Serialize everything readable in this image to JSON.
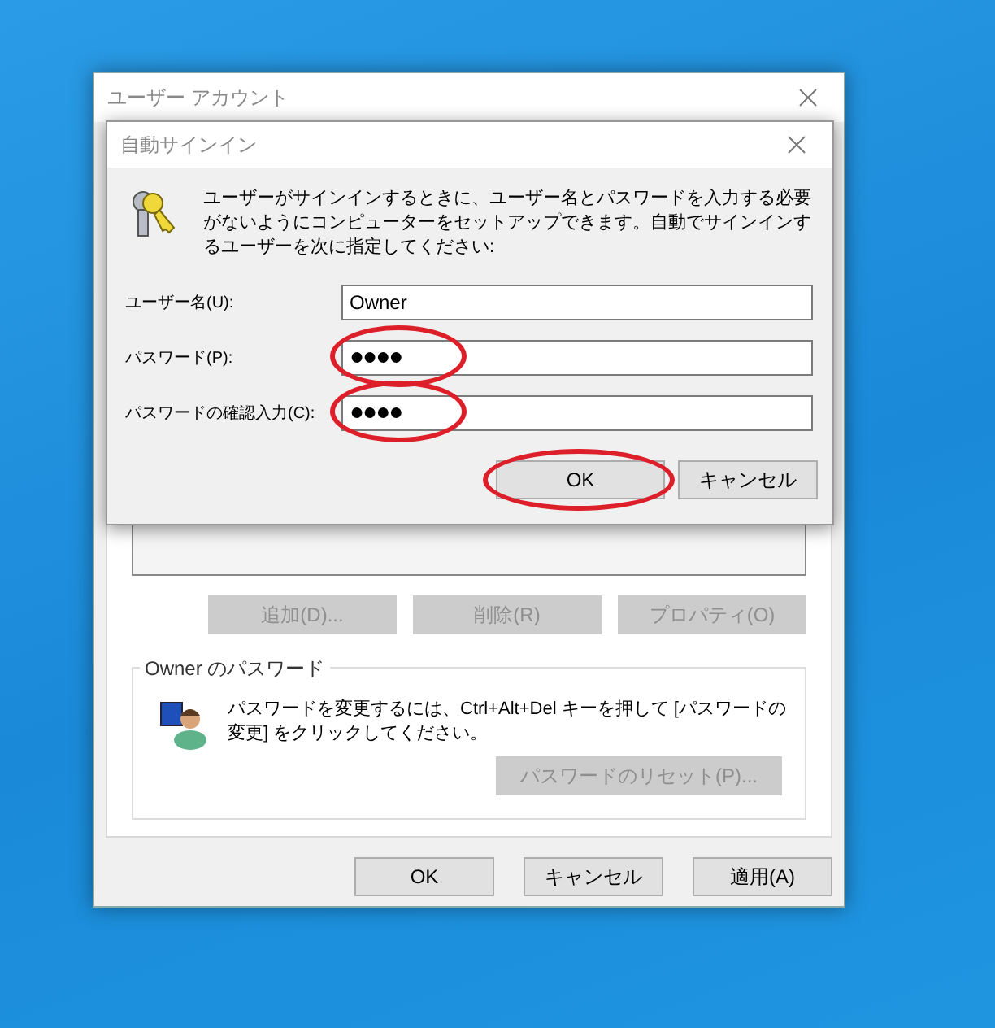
{
  "window": {
    "title": "ユーザー アカウント"
  },
  "list_buttons": [
    {
      "label": "追加(D)...",
      "disabled": true
    },
    {
      "label": "削除(R)",
      "disabled": true
    },
    {
      "label": "プロパティ(O)",
      "disabled": true
    }
  ],
  "password_group": {
    "title": "Owner のパスワード",
    "text": "パスワードを変更するには、Ctrl+Alt+Del キーを押して [パスワードの変更] をクリックしてください。",
    "reset_button": {
      "label": "パスワードのリセット(P)...",
      "disabled": true
    }
  },
  "buttons": [
    {
      "label": "OK"
    },
    {
      "label": "キャンセル"
    },
    {
      "label": "適用(A)"
    }
  ],
  "dialog": {
    "title": "自動サインイン",
    "description": "ユーザーがサインインするときに、ユーザー名とパスワードを入力する必要がないようにコンピューターをセットアップできます。自動でサインインするユーザーを次に指定してください:",
    "fields": [
      {
        "label": "ユーザー名(U):",
        "value": "Owner",
        "kind": "text",
        "highlighted": false
      },
      {
        "label": "パスワード(P):",
        "value": "●●●●",
        "kind": "password",
        "highlighted": true
      },
      {
        "label": "パスワードの確認入力(C):",
        "value": "●●●●",
        "kind": "password",
        "highlighted": true
      }
    ],
    "buttons": [
      {
        "label": "OK",
        "highlighted": true
      },
      {
        "label": "キャンセル",
        "highlighted": false
      }
    ]
  }
}
